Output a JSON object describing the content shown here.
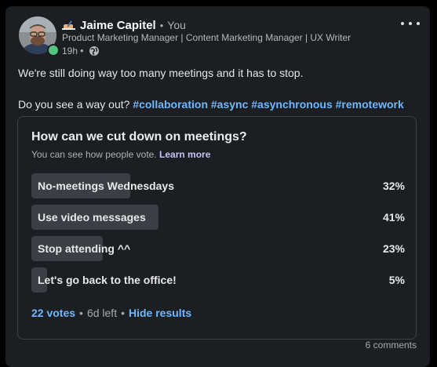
{
  "post": {
    "author_name": "Jaime Capitel",
    "degree": "You",
    "headline": "Product Marketing Manager | Content Marketing Manager | UX Writer",
    "time": "19h",
    "visibility_icon": "globe-icon",
    "online_status_color": "#57c47b",
    "body_line1": "We're still doing way too many meetings and it has to stop.",
    "body_line2_text": "Do you see a way out?",
    "hashtags": [
      "#collaboration",
      "#async",
      "#asynchronous",
      "#remotework"
    ]
  },
  "poll": {
    "question": "How can we cut down on meetings?",
    "note": "You can see how people vote.",
    "learn_more": "Learn more",
    "options": [
      {
        "label": "No-meetings Wednesdays",
        "percent_label": "32%",
        "percent": 32
      },
      {
        "label": "Use video messages",
        "percent_label": "41%",
        "percent": 41
      },
      {
        "label": "Stop attending ^^",
        "percent_label": "23%",
        "percent": 23
      },
      {
        "label": "Let's go back to the office!",
        "percent_label": "5%",
        "percent": 5
      }
    ],
    "votes": "22 votes",
    "time_left": "6d left",
    "hide_results": "Hide results"
  },
  "footer": {
    "comments": "6 comments"
  },
  "colors": {
    "card_background": "#1b1f23",
    "link_blue": "#71b7fb",
    "learn_more": "#c9c2f5",
    "bar_fill": "#3a3f45"
  }
}
